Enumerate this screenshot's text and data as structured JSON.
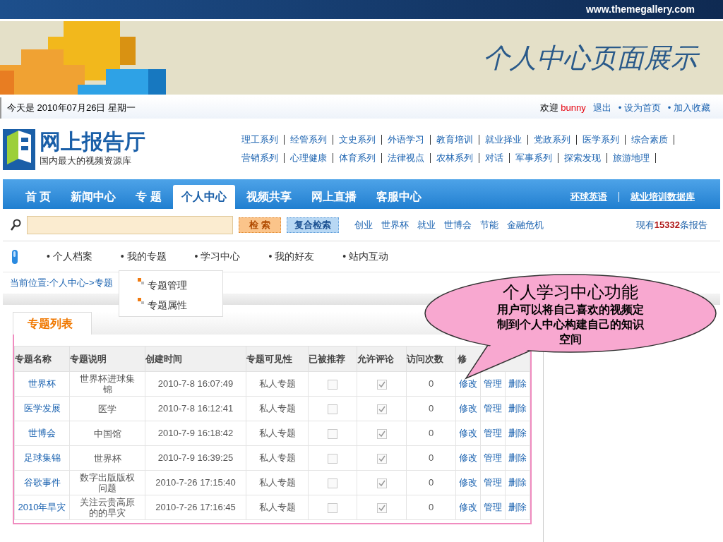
{
  "slide": {
    "header_text": "www.themegallery.com",
    "title": "个人中心页面展示"
  },
  "top_bar": {
    "date": "今天是 2010年07月26日 星期一",
    "welcome": "欢迎",
    "user": "bunny",
    "logout": "退出",
    "links": [
      "• 设为首页",
      "• 加入收藏"
    ]
  },
  "logo": {
    "name": "网上报告厅",
    "tagline": "国内最大的视频资源库"
  },
  "category_links": [
    [
      "理工系列",
      "经管系列",
      "文史系列",
      "外语学习",
      "教育培训",
      "就业择业",
      "党政系列",
      "医学系列",
      "综合素质"
    ],
    [
      "营销系列",
      "心理健康",
      "体育系列",
      "法律视点",
      "农林系列",
      "对话",
      "军事系列",
      "探索发现",
      "旅游地理"
    ]
  ],
  "nav_tabs": [
    {
      "label": "首 页",
      "selected": false
    },
    {
      "label": "新闻中心",
      "selected": false
    },
    {
      "label": "专 题",
      "selected": false
    },
    {
      "label": "个人中心",
      "selected": true
    },
    {
      "label": "视频共享",
      "selected": false
    },
    {
      "label": "网上直播",
      "selected": false
    },
    {
      "label": "客服中心",
      "selected": false
    }
  ],
  "nav_links": [
    "环球英语",
    "就业培训数据库"
  ],
  "search": {
    "search_button": "检 索",
    "advanced_button": "复合检索",
    "hot_words": [
      "创业",
      "世界杯",
      "就业",
      "世博会",
      "节能",
      "金融危机"
    ],
    "report_count": "现有**15332**条报告"
  },
  "sub_nav": [
    "• 个人档案",
    "• 我的专题",
    "• 学习中心",
    "• 我的好友",
    "• 站内互动"
  ],
  "breadcrumb": "当前位置:个人中心->专题",
  "dropdown": [
    "专题管理",
    "专题属性"
  ],
  "panel_tab": "专题列表",
  "table": {
    "columns": [
      "专题名称",
      "专题说明",
      "创建时间",
      "专题可见性",
      "已被推荐",
      "允许评论",
      "访问次数",
      "修"
    ],
    "rows": [
      {
        "name": "世界杯",
        "description": "世界杯进球集锦",
        "created": "2010-7-8 16:07:49",
        "visibility": "私人专题",
        "recommended": false,
        "allow_comments": true,
        "visits": "0",
        "actions": [
          "修改",
          "管理",
          "删除"
        ]
      },
      {
        "name": "医学发展",
        "description": "医学",
        "created": "2010-7-8 16:12:41",
        "visibility": "私人专题",
        "recommended": false,
        "allow_comments": true,
        "visits": "0",
        "actions": [
          "修改",
          "管理",
          "删除"
        ]
      },
      {
        "name": "世博会",
        "description": "中国馆",
        "created": "2010-7-9 16:18:42",
        "visibility": "私人专题",
        "recommended": false,
        "allow_comments": true,
        "visits": "0",
        "actions": [
          "修改",
          "管理",
          "删除"
        ]
      },
      {
        "name": "足球集锦",
        "description": "世界杯",
        "created": "2010-7-9 16:39:25",
        "visibility": "私人专题",
        "recommended": false,
        "allow_comments": true,
        "visits": "0",
        "actions": [
          "修改",
          "管理",
          "删除"
        ]
      },
      {
        "name": "谷歌事件",
        "description": "数字出版版权问题",
        "created": "2010-7-26 17:15:40",
        "visibility": "私人专题",
        "recommended": false,
        "allow_comments": true,
        "visits": "0",
        "actions": [
          "修改",
          "管理",
          "删除"
        ]
      },
      {
        "name": "2010年旱灾",
        "description": "关注云贵高原的的旱灾",
        "created": "2010-7-26 17:16:45",
        "visibility": "私人专题",
        "recommended": false,
        "allow_comments": true,
        "visits": "0",
        "actions": [
          "修改",
          "管理",
          "删除"
        ]
      }
    ]
  },
  "callout": {
    "title": "个人学习中心功能",
    "text": "用户可以将自己喜欢的视频定制到个人中心构建自己的知识空间"
  }
}
